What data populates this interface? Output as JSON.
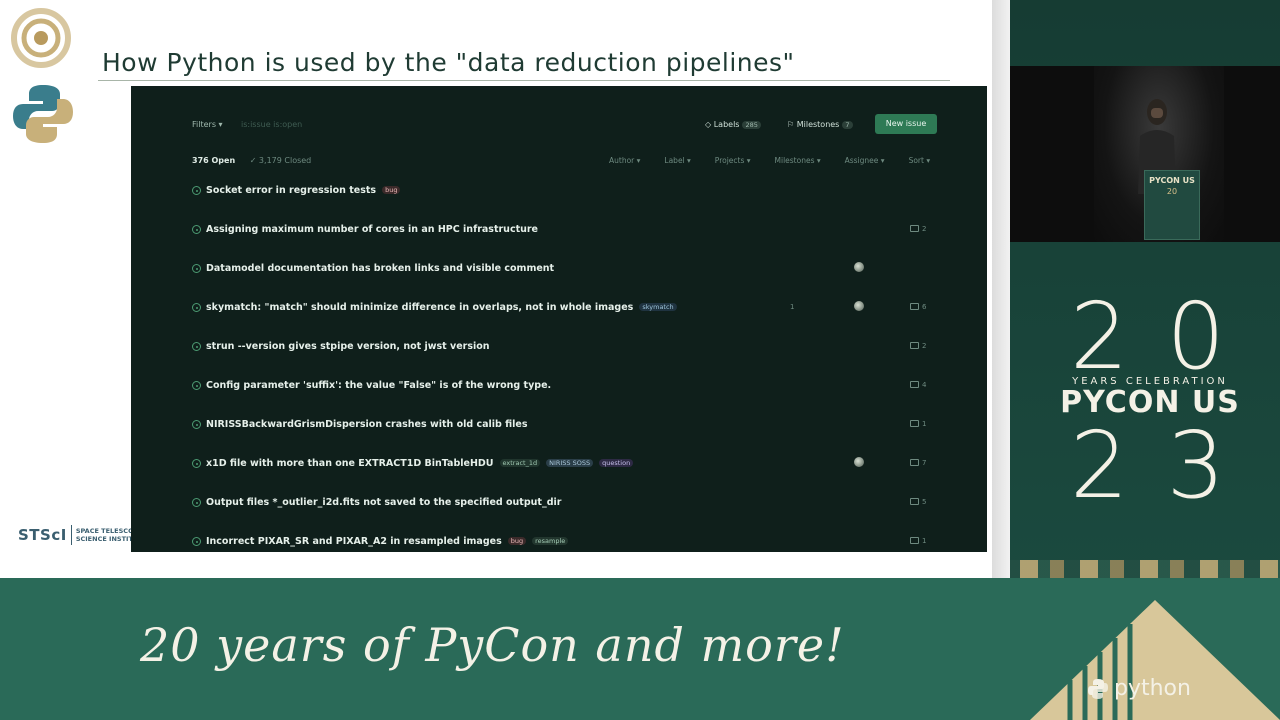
{
  "slide": {
    "title": "How Python is used by the \"data reduction pipelines\"",
    "org_short": "STScI",
    "org_long_1": "SPACE TELESCOPE",
    "org_long_2": "SCIENCE INSTITUTE"
  },
  "github": {
    "filters_label": "Filters ▾",
    "search_placeholder": "is:issue is:open",
    "labels_label": "Labels",
    "labels_count": "285",
    "milestones_label": "Milestones",
    "milestones_count": "7",
    "new_issue_label": "New issue",
    "open_count": "376 Open",
    "closed_count": "✓ 3,179 Closed",
    "sorters": [
      "Author ▾",
      "Label ▾",
      "Projects ▾",
      "Milestones ▾",
      "Assignee ▾",
      "Sort ▾"
    ],
    "issues": [
      {
        "title": "Socket error in regression tests",
        "labels": [
          {
            "text": "bug",
            "bg": "#3b2a2a",
            "fg": "#e8b7b7"
          }
        ],
        "comments": "",
        "avatar": false,
        "pr": ""
      },
      {
        "title": "Assigning maximum number of cores in an HPC infrastructure",
        "labels": [],
        "comments": "2",
        "avatar": false,
        "pr": ""
      },
      {
        "title": "Datamodel documentation has broken links and visible comment",
        "labels": [],
        "comments": "",
        "avatar": true,
        "pr": ""
      },
      {
        "title": "skymatch: \"match\" should minimize difference in overlaps, not in whole images",
        "labels": [
          {
            "text": "skymatch",
            "bg": "#1f3340",
            "fg": "#9cc3d8"
          }
        ],
        "comments": "6",
        "avatar": true,
        "pr": "1"
      },
      {
        "title": "strun --version gives stpipe version, not jwst version",
        "labels": [],
        "comments": "2",
        "avatar": false,
        "pr": ""
      },
      {
        "title": "Config parameter 'suffix': the value \"False\" is of the wrong type.",
        "labels": [],
        "comments": "4",
        "avatar": false,
        "pr": ""
      },
      {
        "title": "NIRISSBackwardGrismDispersion crashes with old calib files",
        "labels": [],
        "comments": "1",
        "avatar": false,
        "pr": ""
      },
      {
        "title": "x1D file with more than one EXTRACT1D BinTableHDU",
        "labels": [
          {
            "text": "extract_1d",
            "bg": "#20352d",
            "fg": "#9fc8b1"
          },
          {
            "text": "NIRISS SOSS",
            "bg": "#2a3e48",
            "fg": "#a9c6d8"
          },
          {
            "text": "question",
            "bg": "#2d2a44",
            "fg": "#c3bde8"
          }
        ],
        "comments": "7",
        "avatar": true,
        "pr": ""
      },
      {
        "title": "Output files *_outlier_i2d.fits not saved to the specified output_dir",
        "labels": [],
        "comments": "5",
        "avatar": false,
        "pr": ""
      },
      {
        "title": "Incorrect PIXAR_SR and PIXAR_A2 in resampled images",
        "labels": [
          {
            "text": "bug",
            "bg": "#3b2a2a",
            "fg": "#e8b7b7"
          },
          {
            "text": "resample",
            "bg": "#22362e",
            "fg": "#a5cdb6"
          }
        ],
        "comments": "1",
        "avatar": false,
        "pr": ""
      }
    ]
  },
  "video": {
    "podium_line1": "PYCON US",
    "podium_line2": "20"
  },
  "badge": {
    "top_number": "20",
    "years": "YEARS CELEBRATION",
    "name": "PYCON US",
    "bottom_number": "23"
  },
  "footer": {
    "tagline": "20 years of PyCon and more!",
    "python_word": "python"
  }
}
